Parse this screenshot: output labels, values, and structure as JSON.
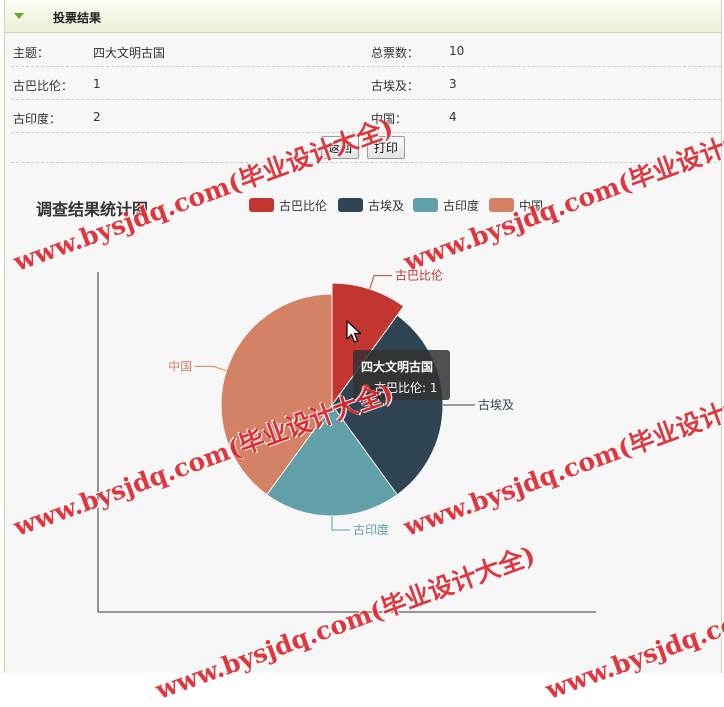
{
  "panel": {
    "title": "投票结果"
  },
  "info": {
    "rows": [
      {
        "label1": "主题：",
        "value1": "四大文明古国",
        "label2": "总票数：",
        "value2": "10"
      },
      {
        "label1": "古巴比伦：",
        "value1": "1",
        "label2": "古埃及：",
        "value2": "3"
      },
      {
        "label1": "古印度：",
        "value1": "2",
        "label2": "中国：",
        "value2": "4"
      }
    ]
  },
  "buttons": {
    "back": "返回",
    "print": "打印"
  },
  "chart_data": {
    "type": "pie",
    "title": "调查结果统计图",
    "legend_position": "top",
    "categories": [
      "古巴比伦",
      "古埃及",
      "古印度",
      "中国"
    ],
    "values": [
      1,
      3,
      2,
      4
    ],
    "colors": [
      "#c23531",
      "#2f4554",
      "#61a0a8",
      "#d48265"
    ],
    "highlighted": "古巴比伦"
  },
  "tooltip": {
    "title": "四大文明古国",
    "series": "古巴比伦",
    "value": "1"
  },
  "watermark": {
    "text": "www.bysjdq.com(毕业设计大全)"
  },
  "cursor": {
    "name": "arrow"
  }
}
